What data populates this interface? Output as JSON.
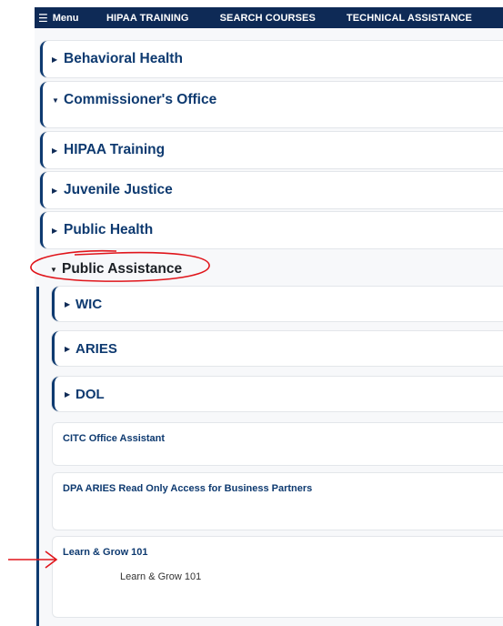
{
  "nav": {
    "menu_label": "Menu",
    "links": [
      "HIPAA TRAINING",
      "SEARCH COURSES",
      "TECHNICAL ASSISTANCE"
    ]
  },
  "categories": {
    "behavioral_health": "Behavioral Health",
    "commissioners_office": "Commissioner's Office",
    "hipaa_training": "HIPAA Training",
    "juvenile_justice": "Juvenile Justice",
    "public_health": "Public Health",
    "public_assistance": "Public Assistance"
  },
  "public_assistance": {
    "subcategories": [
      "WIC",
      "ARIES",
      "DOL"
    ],
    "courses": [
      {
        "title": "CITC Office Assistant",
        "description": ""
      },
      {
        "title": "DPA ARIES Read Only Access for Business Partners",
        "description": ""
      },
      {
        "title": "Learn & Grow 101",
        "description": "Learn & Grow 101"
      }
    ]
  },
  "colors": {
    "nav_bg": "#0e2a56",
    "accent": "#0e3a70",
    "annotation": "#e0151b"
  }
}
